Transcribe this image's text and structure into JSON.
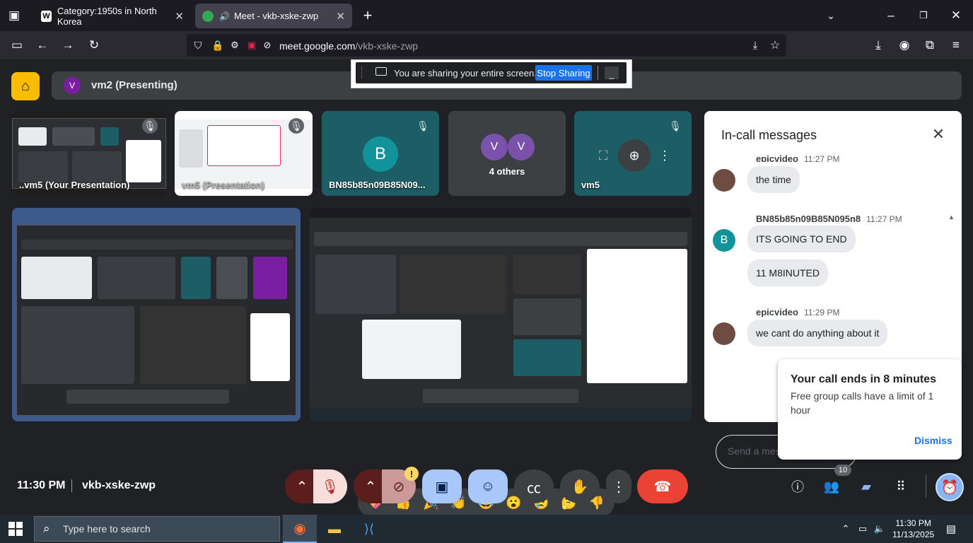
{
  "browser": {
    "tabs": [
      {
        "label": "Category:1950s in North Korea",
        "favicon": "W"
      },
      {
        "label": "Meet - vkb-xske-zwp",
        "favicon": "meet"
      }
    ],
    "url_host": "meet.google.com",
    "url_path": "/vkb-xske-zwp"
  },
  "meet": {
    "presenter_initial": "V",
    "presenter_label": "vm2 (Presenting)",
    "share_banner": {
      "text": "You are sharing your entire screen.",
      "stop_label": "Stop Sharing",
      "min_label": "_"
    },
    "tiles": [
      {
        "name": "..vm5 (Your Presentation)"
      },
      {
        "name": "vm5 (Presentation)"
      },
      {
        "name": "BN85b85n09B85N09...",
        "initial": "B"
      },
      {
        "name": "4 others",
        "initials": [
          "V",
          "V"
        ]
      },
      {
        "name": "vm5"
      }
    ],
    "reactions": [
      "💖",
      "👍",
      "🎉",
      "👏",
      "😂",
      "😮",
      "😢",
      "🤔",
      "👎"
    ]
  },
  "chat": {
    "title": "In-call messages",
    "messages": [
      {
        "sender": "epicvideo",
        "time": "11:27 PM",
        "texts": [
          "the time"
        ]
      },
      {
        "sender": "BN85b85n09B85N095n8",
        "time": "11:27 PM",
        "initial": "B",
        "texts": [
          "ITS GOING TO END",
          "11 M8INUTED"
        ]
      },
      {
        "sender": "epicvideo",
        "time": "11:29 PM",
        "texts": [
          "we cant do anything about it"
        ]
      }
    ],
    "input_placeholder": "Send a mes"
  },
  "toast": {
    "title": "Your call ends in 8 minutes",
    "body": "Free group calls have a limit of 1 hour",
    "dismiss": "Dismiss"
  },
  "controls": {
    "time": "11:30 PM",
    "meeting_code": "vkb-xske-zwp",
    "people_count": "10",
    "camera_alert": "!"
  },
  "taskbar": {
    "search_placeholder": "Type here to search",
    "clock_time": "11:30 PM",
    "clock_date": "11/13/2025"
  },
  "colors": {
    "accent": "#1a73e8",
    "end_call": "#ea4335",
    "meet_bg": "#202124",
    "tile_bg": "#3c4043",
    "teal_tile": "#1d5e66",
    "presenter_purple": "#7b1fa2",
    "avatar_teal": "#12939a"
  }
}
